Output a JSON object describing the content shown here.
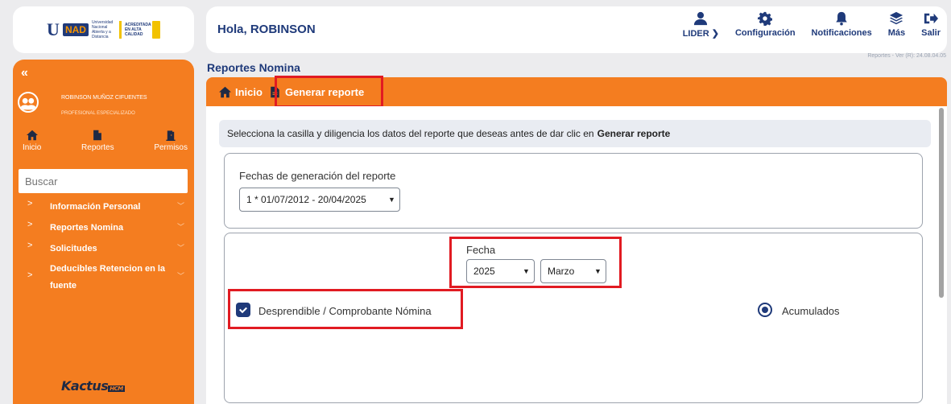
{
  "logo": {
    "u": "U",
    "nad": "NAD",
    "mid": "Universidad Nacional Abierta y a Distancia",
    "acred": "ACREDITADA EN ALTA CALIDAD"
  },
  "header": {
    "greeting": "Hola, ROBINSON",
    "version": "Reportes - Ver (R): 24.08.04.05"
  },
  "top_nav": [
    {
      "label": "LIDER ❯",
      "icon": "user-icon"
    },
    {
      "label": "Configuración",
      "icon": "gear-icon"
    },
    {
      "label": "Notificaciones",
      "icon": "bell-icon"
    },
    {
      "label": "Más",
      "icon": "layers-icon"
    },
    {
      "label": "Salir",
      "icon": "logout-icon"
    }
  ],
  "sidebar": {
    "collapse": "«",
    "user_name": "ROBINSON MUÑOZ CIFUENTES",
    "user_role": "PROFESIONAL ESPECIALIZADO",
    "quick": [
      "Inicio",
      "Reportes",
      "Permisos"
    ],
    "search_placeholder": "Buscar",
    "menu": [
      "Información Personal",
      "Reportes Nomina",
      "Solicitudes",
      "Deducibles Retencion en la fuente"
    ],
    "brand": "Kactus",
    "brand_tag": "HCM"
  },
  "main": {
    "title": "Reportes Nomina",
    "crumbs": {
      "home": "Inicio",
      "current": "Generar reporte"
    },
    "info_text": "Selecciona la casilla y diligencia los datos del reporte que deseas antes de dar clic en",
    "info_bold": "Generar reporte",
    "fechas_label": "Fechas de generación del reporte",
    "fechas_value": "1 * 01/07/2012 - 20/04/2025",
    "fecha_label": "Fecha",
    "year": "2025",
    "month": "Marzo",
    "checkbox_label": "Desprendible / Comprobante Nómina",
    "radio_label": "Acumulados"
  },
  "colors": {
    "orange": "#f47d20",
    "navy": "#1f3a7a",
    "highlight": "#e11b22"
  }
}
